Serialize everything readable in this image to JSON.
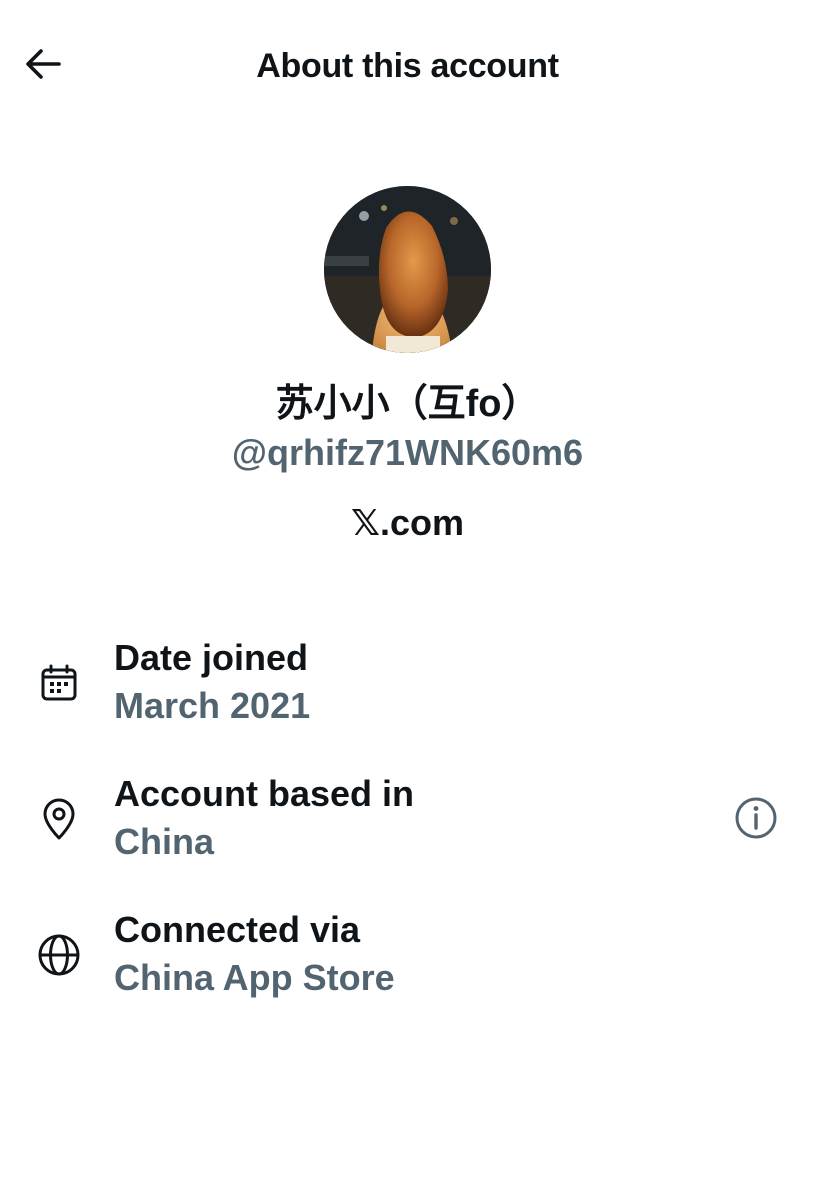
{
  "header": {
    "title": "About this account",
    "back_icon": "arrow-left-icon"
  },
  "profile": {
    "display_name": "苏小小（互fo）",
    "handle": "@qrhifz71WNK60m6",
    "source": "𝕏.com"
  },
  "details": [
    {
      "icon": "calendar-icon",
      "label": "Date joined",
      "value": "March 2021"
    },
    {
      "icon": "location-pin-icon",
      "label": "Account based in",
      "value": "China",
      "info_icon": "info-icon"
    },
    {
      "icon": "globe-icon",
      "label": "Connected via",
      "value": "China App Store"
    }
  ],
  "colors": {
    "primary_text": "#0f1419",
    "secondary_text": "#536471",
    "background": "#ffffff"
  }
}
